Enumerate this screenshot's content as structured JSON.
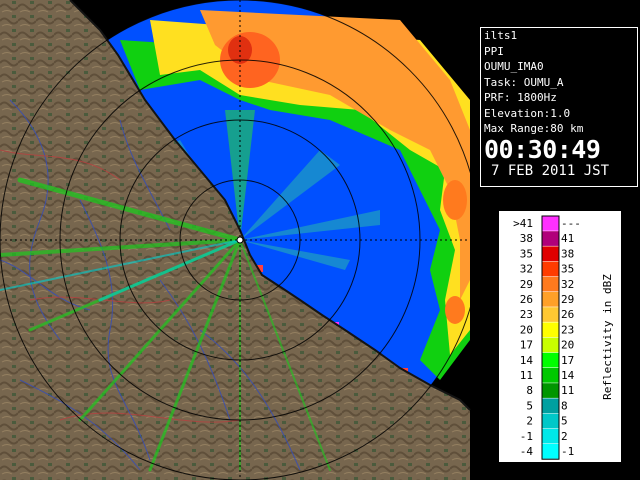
{
  "info": {
    "site": "ilts1",
    "scan_type": "PPI",
    "product": "OUMU_IMA0",
    "task": "Task: OUMU_A",
    "prf": "PRF: 1800Hz",
    "elevation": "Elevation:1.0",
    "max_range": "Max Range:80 km",
    "time": "00:30:49",
    "date": "7 FEB 2011 JST"
  },
  "legend": {
    "title": "Reflectivity in dBZ",
    "rows": [
      {
        "low": ">41",
        "high": "---",
        "color": "#ff30ff"
      },
      {
        "low": "38",
        "high": "41",
        "color": "#b0007a"
      },
      {
        "low": "35",
        "high": "38",
        "color": "#e00000"
      },
      {
        "low": "32",
        "high": "35",
        "color": "#ff3c00"
      },
      {
        "low": "29",
        "high": "32",
        "color": "#ff7a1e"
      },
      {
        "low": "26",
        "high": "29",
        "color": "#ffa028"
      },
      {
        "low": "23",
        "high": "26",
        "color": "#ffc832"
      },
      {
        "low": "20",
        "high": "23",
        "color": "#ffff00"
      },
      {
        "low": "17",
        "high": "20",
        "color": "#c8ff00"
      },
      {
        "low": "14",
        "high": "17",
        "color": "#00ff00"
      },
      {
        "low": "11",
        "high": "14",
        "color": "#00c800"
      },
      {
        "low": "8",
        "high": "11",
        "color": "#009600"
      },
      {
        "low": "5",
        "high": "8",
        "color": "#00a0a0"
      },
      {
        "low": "2",
        "high": "5",
        "color": "#00c8c8"
      },
      {
        "low": "-1",
        "high": "2",
        "color": "#00e8e8"
      },
      {
        "low": "-4",
        "high": "-1",
        "color": "#00ffff"
      }
    ]
  },
  "colors": {
    "background": "#000000",
    "low_echo": "#0050ff",
    "terrain": "#7a6a50",
    "coastline": "#141414"
  }
}
